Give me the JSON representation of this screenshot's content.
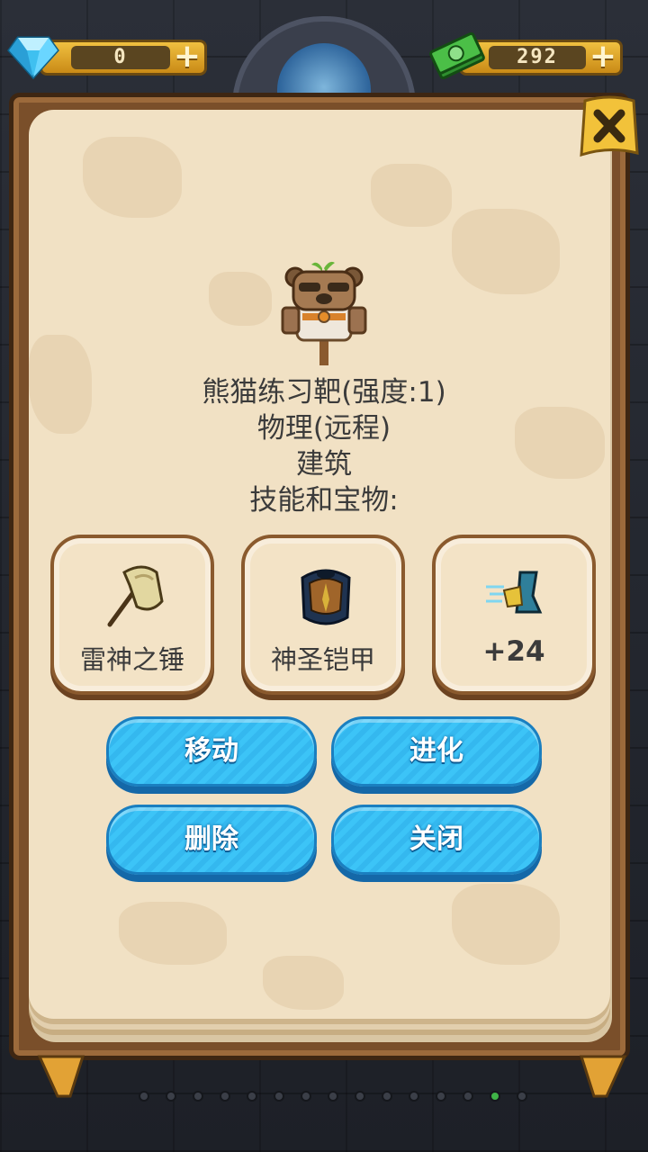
{
  "currency": {
    "gems": {
      "value": "0",
      "icon": "diamond-icon"
    },
    "cash": {
      "value": "292",
      "icon": "cash-icon"
    },
    "plus": "+"
  },
  "close_icon": "close-icon",
  "pet": {
    "name_line": "熊猫练习靶(强度:1)",
    "type_line": "物理(远程)",
    "category_line": "建筑",
    "skills_header": "技能和宝物:"
  },
  "slots": [
    {
      "label": "雷神之锤",
      "icon": "hammer-icon"
    },
    {
      "label": "神圣铠甲",
      "icon": "armor-icon"
    },
    {
      "label": "+24",
      "icon": "speed-boot-icon"
    }
  ],
  "buttons": {
    "move": "移动",
    "evolve": "进化",
    "delete": "删除",
    "close": "关闭"
  },
  "pager": {
    "total": 15,
    "active_index": 13
  },
  "colors": {
    "button": "#3cc4f7",
    "paper": "#f1e1c4",
    "frame": "#7a4f2a",
    "active_dot": "#3fb347"
  }
}
